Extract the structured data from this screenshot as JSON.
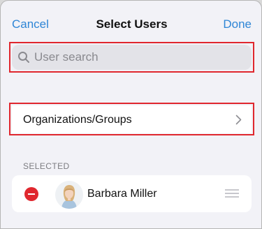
{
  "navbar": {
    "cancel_label": "Cancel",
    "title": "Select Users",
    "done_label": "Done"
  },
  "search": {
    "placeholder": "User search",
    "value": ""
  },
  "organizations": {
    "label": "Organizations/Groups"
  },
  "selected": {
    "header": "SELECTED",
    "users": [
      {
        "name": "Barbara Miller"
      }
    ]
  },
  "colors": {
    "accent": "#2f86d6",
    "highlight": "#e0272e",
    "remove": "#e0272e",
    "background": "#f2f2f7"
  }
}
